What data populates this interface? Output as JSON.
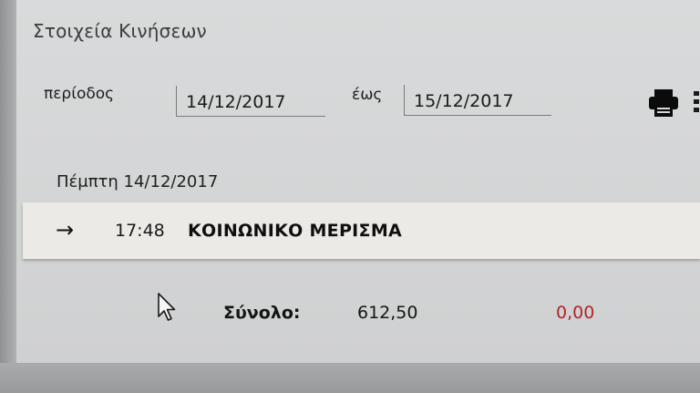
{
  "header": {
    "title": "Στοιχεία Κινήσεων"
  },
  "filter": {
    "period_label": "περίοδος",
    "from_date": "14/12/2017",
    "to_label": "έως",
    "to_date": "15/12/2017",
    "print_icon": "printer-icon",
    "more_icon": "more-options-icon"
  },
  "transactions": {
    "day_header": "Πέμπτη 14/12/2017",
    "rows": [
      {
        "direction_symbol": "→",
        "time": "17:48",
        "description": "ΚΟΙΝΩΝΙΚΟ ΜΕΡΙΣΜΑ"
      }
    ]
  },
  "summary": {
    "total_label": "Σύνολο:",
    "total_credit": "612,50",
    "total_debit": "0,00",
    "debit_color": "#b0252a"
  }
}
